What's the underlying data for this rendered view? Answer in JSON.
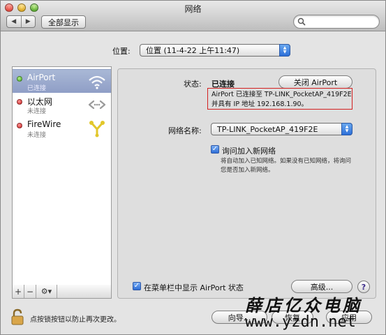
{
  "window": {
    "title": "网络"
  },
  "toolbar": {
    "back_glyph": "◀",
    "forward_glyph": "▶",
    "show_all_label": "全部显示",
    "search_placeholder": ""
  },
  "location": {
    "label": "位置:",
    "value": "位置 (11-4-22 上午11:47)"
  },
  "services": [
    {
      "name": "AirPort",
      "status": "已连接",
      "status_color": "#3fa51f",
      "icon": "wifi-icon"
    },
    {
      "name": "以太网",
      "status": "未连接",
      "status_color": "#c91a1a",
      "icon": "ethernet-icon"
    },
    {
      "name": "FireWire",
      "status": "未连接",
      "status_color": "#c91a1a",
      "icon": "firewire-icon"
    }
  ],
  "sidebar_footer": {
    "add": "+",
    "remove": "−",
    "gear": "⚙▾"
  },
  "detail": {
    "status_label": "状态:",
    "status_value": "已连接",
    "toggle_button": "关闭 AirPort",
    "info_line1": "AirPort 已连接至 TP-LINK_PocketAP_419F2E",
    "info_line2": "并具有 IP 地址 192.168.1.90。",
    "network_label": "网络名称:",
    "network_value": "TP-LINK_PocketAP_419F2E",
    "ask_join_label": "询问加入新网络",
    "ask_join_checked": true,
    "hint_line1": "将自动加入已知网络。如果没有已知网络，将询问",
    "hint_line2": "您是否加入新网络。",
    "menubar_label": "在菜单栏中显示 AirPort 状态",
    "menubar_checked": true,
    "advanced_button": "高级...",
    "help_glyph": "?"
  },
  "footer": {
    "lock_text": "点按锁按钮以防止再次更改。",
    "assistant_button": "向导...",
    "revert_button": "恢复",
    "apply_button": "应用"
  },
  "watermark": {
    "chinese": "薛店亿众电脑",
    "url": "www.yzdn.net"
  },
  "colors": {
    "selection": "#94a3c9",
    "highlight_box": "#d32020",
    "accent": "#2e6ed6"
  }
}
